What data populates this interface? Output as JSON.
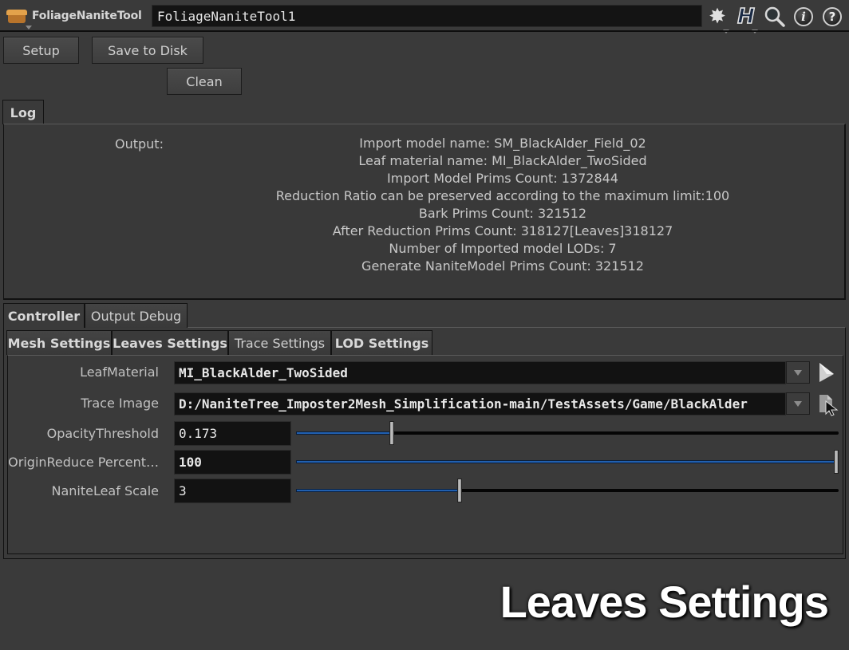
{
  "header": {
    "tool_type": "FoliageNaniteTool",
    "node_name": "FoliageNaniteTool1",
    "icons": [
      "tool-box-icon",
      "gear-icon",
      "houdini-h-icon",
      "search-icon",
      "info-icon",
      "help-icon"
    ],
    "gear_glyph": "✸",
    "h_glyph": "H",
    "info_glyph": "i",
    "help_glyph": "?"
  },
  "buttons": {
    "setup": "Setup",
    "save_to_disk": "Save to Disk",
    "clean": "Clean"
  },
  "log_tab": {
    "label": "Log"
  },
  "log": {
    "output_label": "Output:",
    "lines": [
      "Import model name: SM_BlackAlder_Field_02",
      "Leaf material name: MI_BlackAlder_TwoSided",
      "Import Model Prims Count: 1372844",
      "Reduction Ratio can be preserved according to the maximum limit:100",
      "Bark Prims Count: 321512",
      "After Reduction Prims Count: 318127[Leaves]318127",
      "Number of Imported model LODs: 7",
      "Generate NaniteModel Prims Count: 321512"
    ]
  },
  "main_tabs": [
    {
      "label": "Controller",
      "active": true
    },
    {
      "label": "Output Debug",
      "active": false
    }
  ],
  "sub_tabs": [
    {
      "label": "Mesh Settings",
      "active": false
    },
    {
      "label": "Leaves Settings",
      "active": true
    },
    {
      "label": "Trace Settings",
      "active": false
    },
    {
      "label": "LOD Settings",
      "active": false
    }
  ],
  "parms": {
    "leaf_material": {
      "label": "LeafMaterial",
      "value": "MI_BlackAlder_TwoSided"
    },
    "trace_image": {
      "label": "Trace Image",
      "value": "D:/NaniteTree_Imposter2Mesh_Simplification-main/TestAssets/Game/BlackAlder"
    },
    "opacity_threshold": {
      "label": "OpacityThreshold",
      "value": "0.173",
      "slider_fraction": 0.173
    },
    "origin_reduce": {
      "label": "OriginReduce Percent…",
      "value": "100",
      "slider_fraction": 1.0
    },
    "nanite_leaf_scale": {
      "label": "NaniteLeaf Scale",
      "value": "3",
      "slider_fraction": 0.3
    }
  },
  "overlay_title": "Leaves Settings",
  "colors": {
    "background": "#3a3a3a",
    "slider_fill": "#2160b0",
    "field_bg": "#121212"
  }
}
